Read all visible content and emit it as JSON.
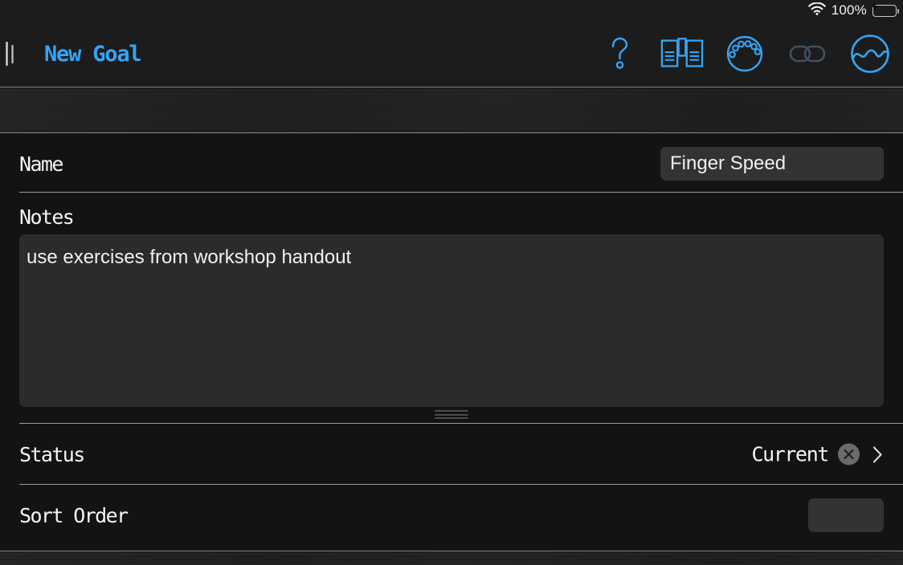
{
  "status_bar": {
    "wifi_icon": "wifi-icon",
    "battery_percent": "100%",
    "battery_icon": "battery-charging-icon"
  },
  "navbar": {
    "split_handle": "split-view-handle",
    "title": "New Goal",
    "title_color": "#35a4f5",
    "icons": [
      {
        "name": "help-question-icon",
        "label": "Help"
      },
      {
        "name": "book-pages-icon",
        "label": "Library"
      },
      {
        "name": "tuner-icon",
        "label": "Tuner"
      },
      {
        "name": "link-chain-icon",
        "label": "Link"
      },
      {
        "name": "metronome-wave-icon",
        "label": "Practice"
      }
    ]
  },
  "form": {
    "name": {
      "label": "Name",
      "value": "Finger Speed",
      "placeholder": ""
    },
    "notes": {
      "label": "Notes",
      "value": "use exercises from workshop handout",
      "placeholder": "",
      "grabber": "resize-grabber"
    },
    "status": {
      "label": "Status",
      "value": "Current",
      "clear_icon": "clear-circle-x-icon",
      "disclosure_icon": "chevron-right-icon"
    },
    "sort_order": {
      "label": "Sort Order",
      "value": "",
      "placeholder": ""
    }
  },
  "colors": {
    "accent": "#35a4f5",
    "bar_background": "#1c1c1c",
    "page_background": "#131313",
    "field_background": "#333333",
    "textarea_background": "#2b2b2b",
    "battery_green": "#34d94b",
    "separator": "#9a9a9a"
  }
}
